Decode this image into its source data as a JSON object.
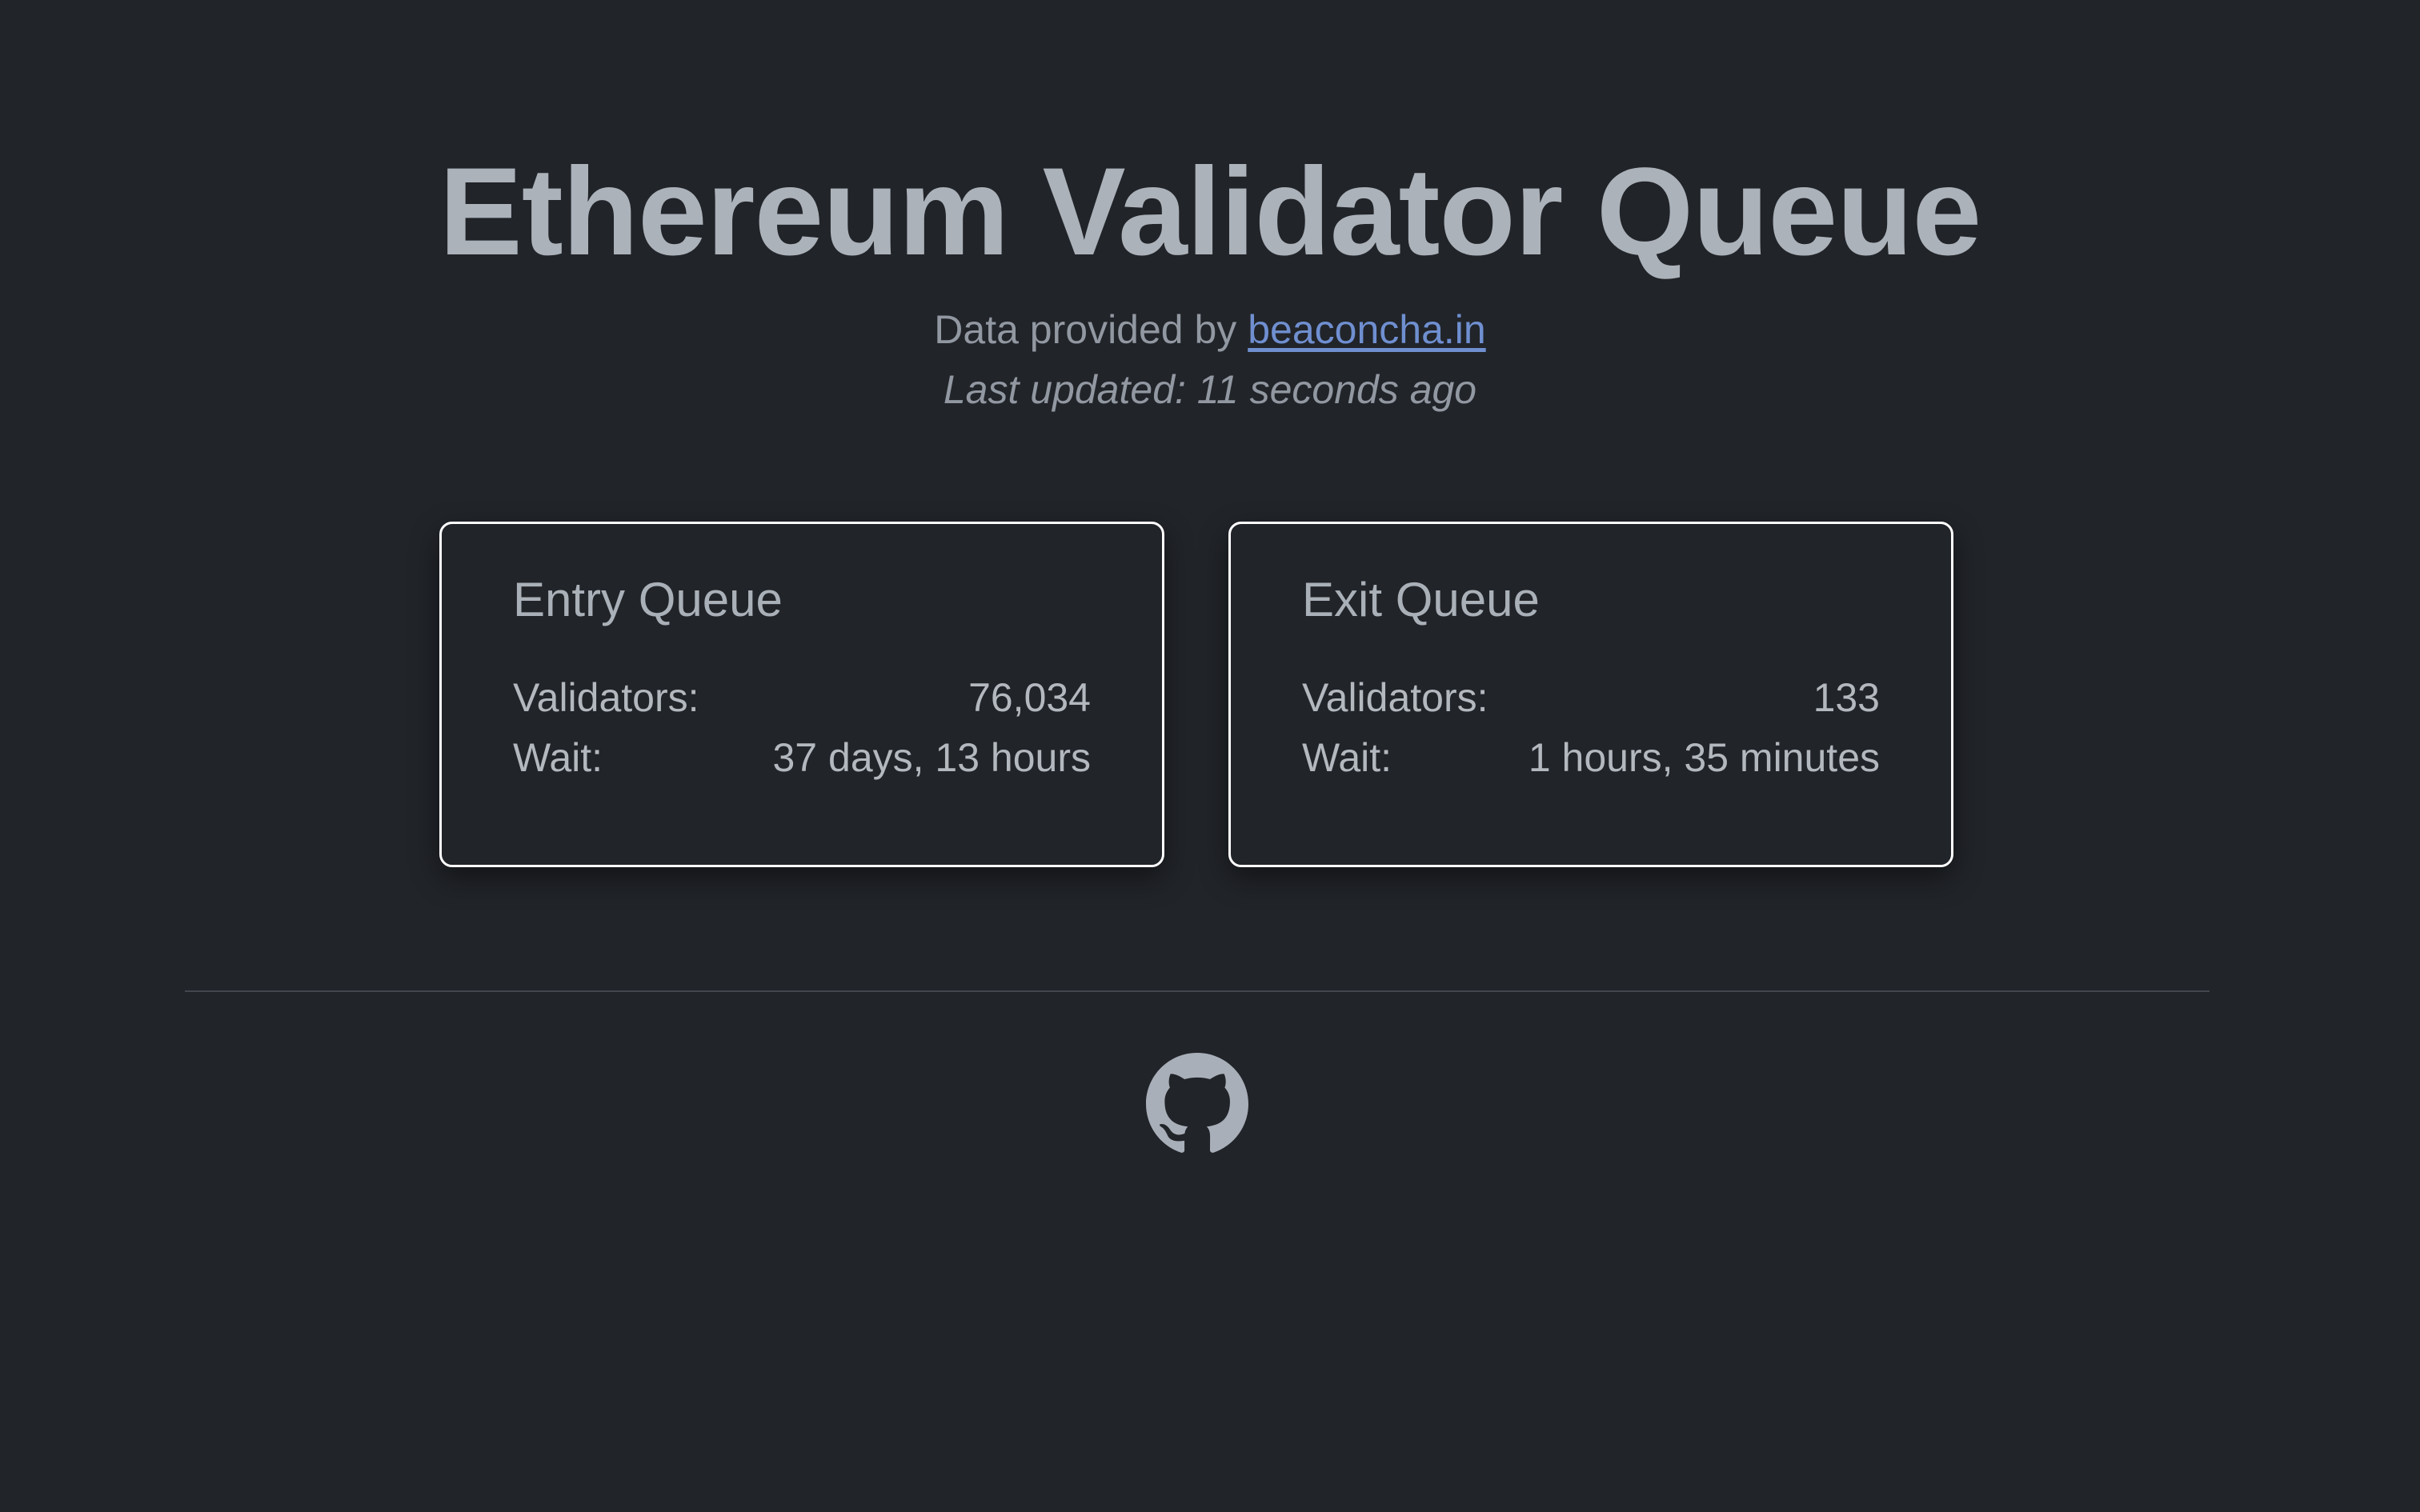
{
  "header": {
    "title": "Ethereum Validator Queue",
    "provided_prefix": "Data provided by",
    "provider_link": "beaconcha.in",
    "last_updated": "Last updated: 11 seconds ago"
  },
  "cards": {
    "entry": {
      "title": "Entry Queue",
      "validators_label": "Validators:",
      "validators_value": "76,034",
      "wait_label": "Wait:",
      "wait_value": "37 days, 13 hours"
    },
    "exit": {
      "title": "Exit Queue",
      "validators_label": "Validators:",
      "validators_value": "133",
      "wait_label": "Wait:",
      "wait_value": "1 hours, 35 minutes"
    }
  },
  "footer": {
    "icon": "github-icon"
  },
  "colors": {
    "background": "#212429",
    "text": "#aab0b8",
    "link": "#6f8fd0",
    "card_border": "#ffffff"
  }
}
